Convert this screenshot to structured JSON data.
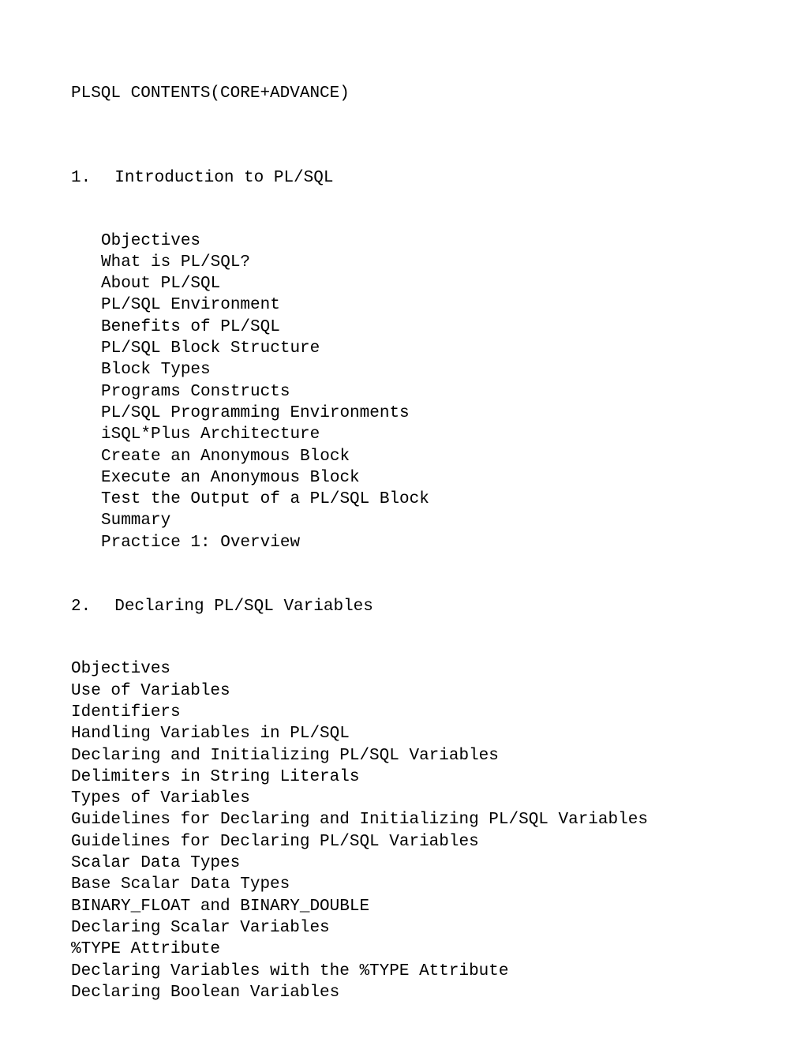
{
  "title": "PLSQL CONTENTS(CORE+ADVANCE)",
  "sections": [
    {
      "number": "1.",
      "heading": "Introduction to PL/SQL",
      "indented": true,
      "items": [
        "Objectives",
        "What is PL/SQL?",
        "About PL/SQL",
        "PL/SQL Environment",
        "Benefits of PL/SQL",
        "PL/SQL Block Structure",
        "Block Types",
        "Programs Constructs",
        "PL/SQL Programming Environments",
        "iSQL*Plus Architecture",
        "Create an Anonymous Block",
        "Execute an Anonymous Block",
        "Test the Output of a PL/SQL Block",
        "Summary",
        "Practice 1: Overview"
      ]
    },
    {
      "number": "2.",
      "heading": "Declaring PL/SQL Variables",
      "indented": false,
      "items": [
        "Objectives",
        "Use of Variables",
        "Identifiers",
        "Handling Variables in PL/SQL",
        "Declaring and Initializing PL/SQL Variables",
        "Delimiters in String Literals",
        "Types of Variables",
        "Guidelines for Declaring and Initializing PL/SQL Variables",
        "Guidelines for Declaring PL/SQL Variables",
        "Scalar Data Types",
        "Base Scalar Data Types",
        "BINARY_FLOAT and BINARY_DOUBLE",
        "Declaring Scalar Variables",
        "%TYPE Attribute",
        "Declaring Variables with the %TYPE Attribute",
        "Declaring Boolean Variables"
      ]
    }
  ]
}
